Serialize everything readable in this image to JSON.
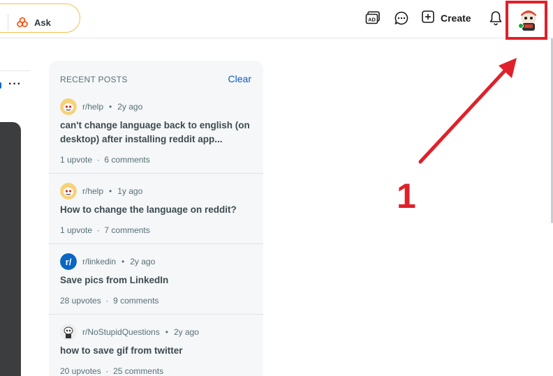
{
  "header": {
    "ask_label": "Ask",
    "create_label": "Create",
    "icons": [
      "ad-icon",
      "chat-icon",
      "plus-icon",
      "bell-icon",
      "avatar"
    ]
  },
  "left": {
    "more_label": "···"
  },
  "recent_posts": {
    "heading": "RECENT POSTS",
    "clear_label": "Clear",
    "posts": [
      {
        "subreddit": "r/help",
        "time": "2y ago",
        "title": "can't change language back to english (on desktop) after installing reddit app...",
        "upvotes": "1 upvote",
        "comments": "6 comments",
        "icon": "snoo-help-icon"
      },
      {
        "subreddit": "r/help",
        "time": "1y ago",
        "title": "How to change the language on reddit?",
        "upvotes": "1 upvote",
        "comments": "7 comments",
        "icon": "snoo-help-icon"
      },
      {
        "subreddit": "r/linkedin",
        "time": "2y ago",
        "title": "Save pics from LinkedIn",
        "upvotes": "28 upvotes",
        "comments": "9 comments",
        "icon": "subreddit-linkedin-icon"
      },
      {
        "subreddit": "r/NoStupidQuestions",
        "time": "2y ago",
        "title": "how to save gif from twitter",
        "upvotes": "20 upvotes",
        "comments": "25 comments",
        "icon": "subreddit-nostupidquestions-icon"
      }
    ]
  },
  "annotation": {
    "number": "1",
    "color": "#e0202a"
  },
  "colors": {
    "accent_link": "#0a5cb7",
    "search_border": "#f2c14e",
    "panel_bg": "#f5f7f9"
  }
}
